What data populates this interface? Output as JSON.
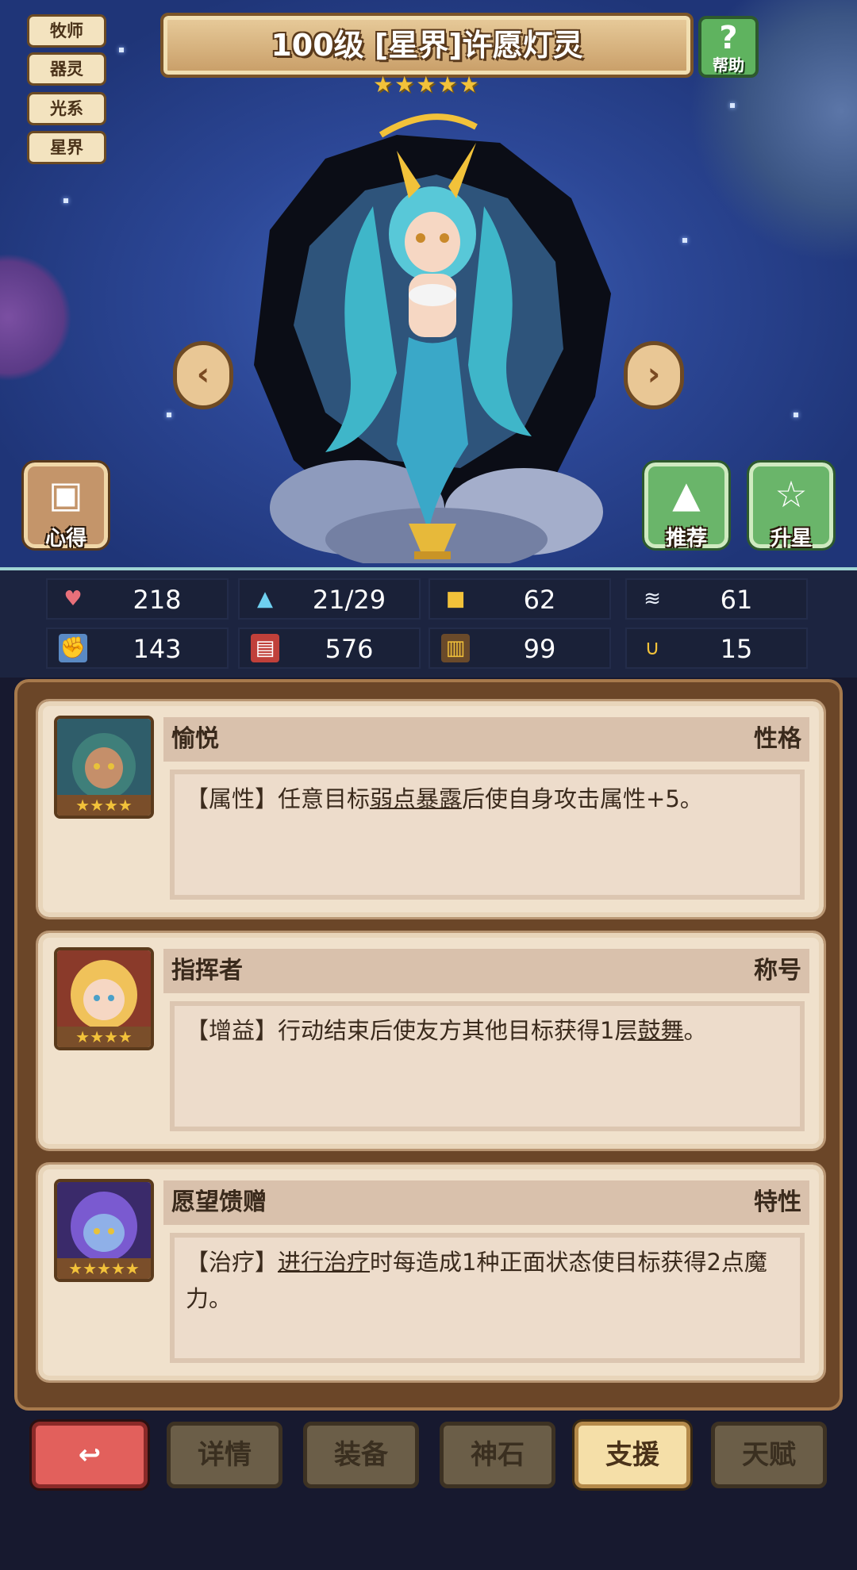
{
  "tags": [
    "牧师",
    "器灵",
    "光系",
    "星界"
  ],
  "hero": {
    "title": "100级 [星界]许愿灯灵",
    "star_count": 5,
    "help_label": "帮助"
  },
  "side_buttons": {
    "insight": "心得",
    "recommend": "推荐",
    "upgrade_star": "升星"
  },
  "stats": [
    {
      "icon": "heart-icon",
      "value": "218"
    },
    {
      "icon": "water-drop-icon",
      "value": "21/29"
    },
    {
      "icon": "shield-icon",
      "value": "62"
    },
    {
      "icon": "wing-icon",
      "value": "61"
    },
    {
      "icon": "fist-icon",
      "value": "143"
    },
    {
      "icon": "book-icon",
      "value": "576"
    },
    {
      "icon": "card-icon",
      "value": "99"
    },
    {
      "icon": "horseshoe-icon",
      "value": "15"
    }
  ],
  "cards": [
    {
      "name": "愉悦",
      "type": "性格",
      "stars": 4,
      "desc_pre": "【属性】任意目标",
      "desc_link": "弱点暴露",
      "desc_post": "后使自身攻击属性+5。"
    },
    {
      "name": "指挥者",
      "type": "称号",
      "stars": 4,
      "desc_pre": "【增益】行动结束后使友方其他目标获得1层",
      "desc_link": "鼓舞",
      "desc_post": "。"
    },
    {
      "name": "愿望馈赠",
      "type": "特性",
      "stars": 5,
      "desc_pre": "【治疗】",
      "desc_link": "进行治疗",
      "desc_post": "时每造成1种正面状态使目标获得2点魔力。"
    }
  ],
  "nav": {
    "back_icon": "back-arrow-icon",
    "tabs": [
      "详情",
      "装备",
      "神石",
      "支援",
      "天赋"
    ],
    "active_tab": "支援"
  },
  "colors": {
    "scene_blue": "#2c4796",
    "panel_brown": "#6b4628",
    "card_bg": "#f0e1cc",
    "active_tab": "#f5dfa8",
    "back_button": "#e2605c"
  }
}
